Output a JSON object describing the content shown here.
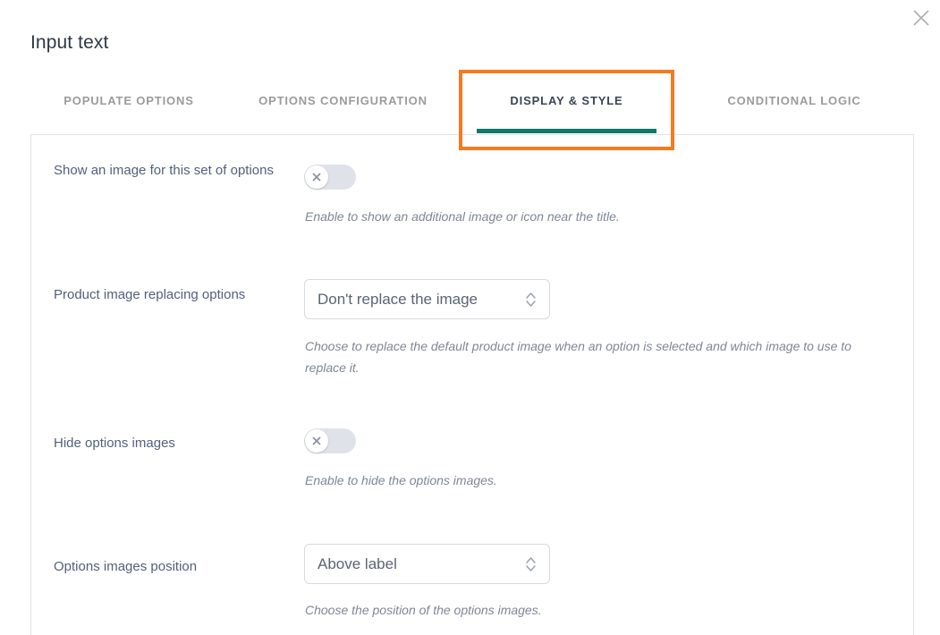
{
  "window": {
    "close_icon": "close-icon"
  },
  "header": {
    "title": "Input text"
  },
  "tabs": {
    "items": [
      {
        "label": "POPULATE OPTIONS",
        "active": false
      },
      {
        "label": "OPTIONS CONFIGURATION",
        "active": false
      },
      {
        "label": "DISPLAY & STYLE",
        "active": true
      },
      {
        "label": "CONDITIONAL LOGIC",
        "active": false
      }
    ],
    "active_underline_color": "#10796a",
    "active_label_color": "#3b4656",
    "inactive_label_color": "#9b9b9b",
    "highlight_color": "#f47b20"
  },
  "settings": {
    "rows": [
      {
        "label": "Show an image for this set of options",
        "control": "toggle",
        "toggle_state": "off",
        "toggle_icon": "x-icon",
        "help": "Enable to show an additional image or icon near the title."
      },
      {
        "label": "Product image replacing options",
        "control": "select",
        "value": "Don't replace the image",
        "help": "Choose to replace the default product image when an option is selected and which image to use to replace it."
      },
      {
        "label": "Hide options images",
        "control": "toggle",
        "toggle_state": "off",
        "toggle_icon": "x-icon",
        "help": "Enable to hide the options images."
      },
      {
        "label": "Options images position",
        "control": "select",
        "value": "Above label",
        "help": "Choose the position of the options images."
      }
    ]
  }
}
